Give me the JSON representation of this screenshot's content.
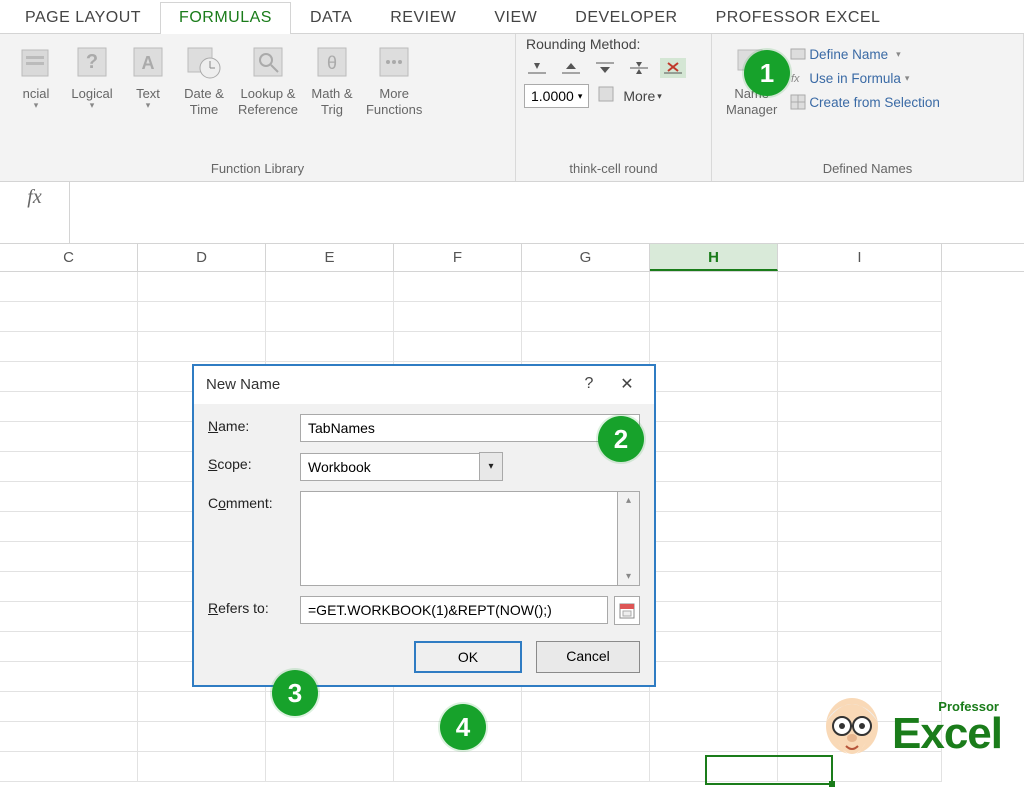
{
  "tabs": {
    "pagelayout": "PAGE LAYOUT",
    "formulas": "FORMULAS",
    "data": "DATA",
    "review": "REVIEW",
    "view": "VIEW",
    "developer": "DEVELOPER",
    "professor": "PROFESSOR EXCEL"
  },
  "ribbon": {
    "functionLibrary": {
      "label": "Function Library",
      "financial": "ncial",
      "logical": "Logical",
      "text": "Text",
      "date": "Date &",
      "time": "Time",
      "lookup": "Lookup &",
      "reference": "Reference",
      "math": "Math &",
      "trig": "Trig",
      "more": "More",
      "functions": "Functions"
    },
    "round": {
      "title": "Rounding Method:",
      "value": "1.0000",
      "more": "More",
      "group": "think-cell round"
    },
    "names": {
      "manager1": "Name",
      "manager2": "Manager",
      "define": "Define Name",
      "use": "Use in Formula",
      "create": "Create from Selection",
      "group": "Defined Names"
    }
  },
  "columns": [
    "C",
    "D",
    "E",
    "F",
    "G",
    "H",
    "I"
  ],
  "selectedColumn": "H",
  "dialog": {
    "title": "New Name",
    "nameLabel": "Name:",
    "nameUnd": "N",
    "nameValue": "TabNames",
    "scopeLabel": "Scope:",
    "scopeUnd": "S",
    "scopeValue": "Workbook",
    "commentLabel": "Comment:",
    "commentUnd": "o",
    "refersLabel": "Refers to:",
    "refersUnd": "R",
    "refersValue": "=GET.WORKBOOK(1)&REPT(NOW();)",
    "ok": "OK",
    "cancel": "Cancel"
  },
  "badges": {
    "one": "1",
    "two": "2",
    "three": "3",
    "four": "4"
  },
  "logo": {
    "small": "Professor",
    "big": "Excel"
  }
}
